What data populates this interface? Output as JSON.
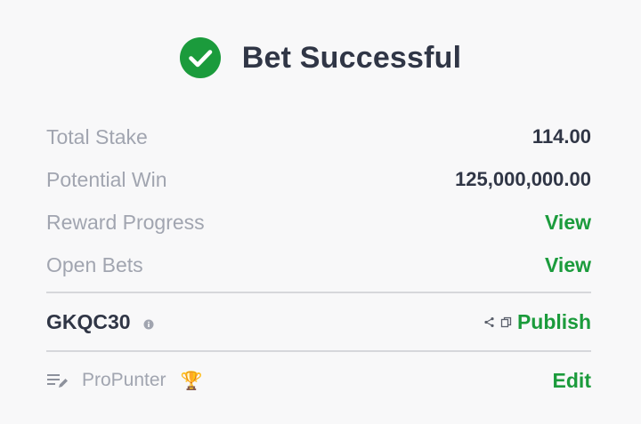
{
  "header": {
    "title": "Bet Successful",
    "icon": "check-circle-icon",
    "success_color": "#1b9b3c"
  },
  "summary": {
    "rows": [
      {
        "label": "Total Stake",
        "value": "114.00"
      },
      {
        "label": "Potential Win",
        "value": "125,000,000.00"
      },
      {
        "label": "Reward Progress",
        "value": "View"
      },
      {
        "label": "Open Bets",
        "value": "View"
      }
    ]
  },
  "booking": {
    "code": "GKQC30",
    "info_icon": "info-icon",
    "share_icon": "share-icon",
    "copy_icon": "copy-icon",
    "publish_label": "Publish"
  },
  "user": {
    "icon": "list-edit-icon",
    "name": "ProPunter",
    "badge": "🏆",
    "edit_label": "Edit"
  }
}
